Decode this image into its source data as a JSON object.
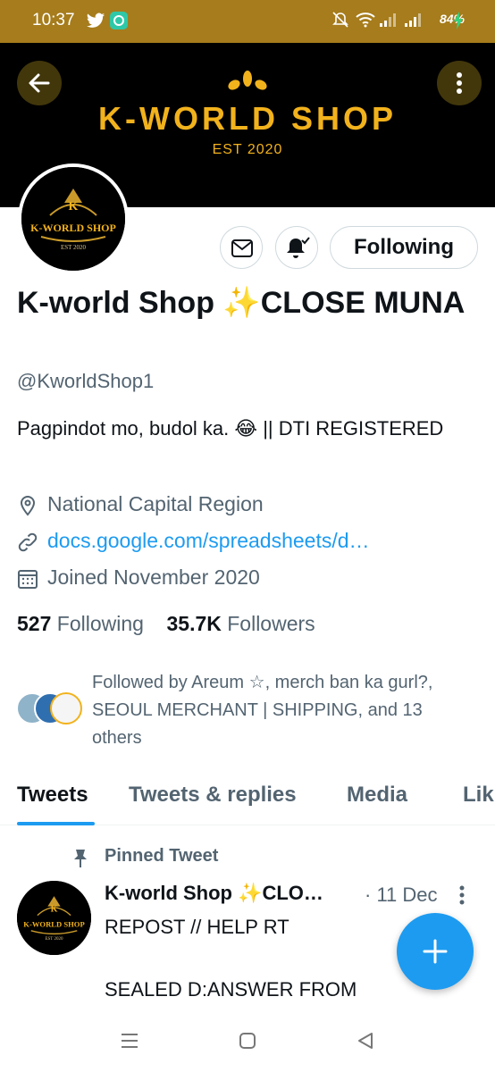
{
  "status_bar": {
    "time": "10:37",
    "battery": "84%"
  },
  "banner": {
    "title": "K-WORLD SHOP",
    "subtitle": "EST 2020"
  },
  "avatar": {
    "logo_text": "K-WORLD SHOP",
    "logo_sub": "EST 2020"
  },
  "actions": {
    "following_label": "Following"
  },
  "profile": {
    "display_name": "K-world Shop ✨CLOSE MUNA",
    "handle": "@KworldShop1",
    "bio": "Pagpindot mo, budol ka. 😂 || DTI REGISTERED",
    "location": "National Capital Region",
    "link": "docs.google.com/spreadsheets/d…",
    "joined": "Joined November 2020"
  },
  "stats": {
    "following_count": "527",
    "following_label": "Following",
    "followers_count": "35.7K",
    "followers_label": "Followers"
  },
  "followed_by": {
    "text": "Followed by Areum ☆, merch ban ka gurl?, SEOUL MERCHANT | SHIPPING, and 13 others"
  },
  "tabs": [
    {
      "label": "Tweets",
      "active": true
    },
    {
      "label": "Tweets & replies",
      "active": false
    },
    {
      "label": "Media",
      "active": false
    },
    {
      "label": "Lik",
      "active": false
    }
  ],
  "pinned_tweet": {
    "label": "Pinned Tweet",
    "name": "K-world Shop ✨CLO…",
    "date": "· 11 Dec",
    "body": "REPOST // HELP RT\n\nSEALED D:ANSWER FROM"
  },
  "colors": {
    "status_bar": "#a67c1c",
    "banner_gold": "#f2b21c",
    "accent": "#1d9bf0"
  }
}
